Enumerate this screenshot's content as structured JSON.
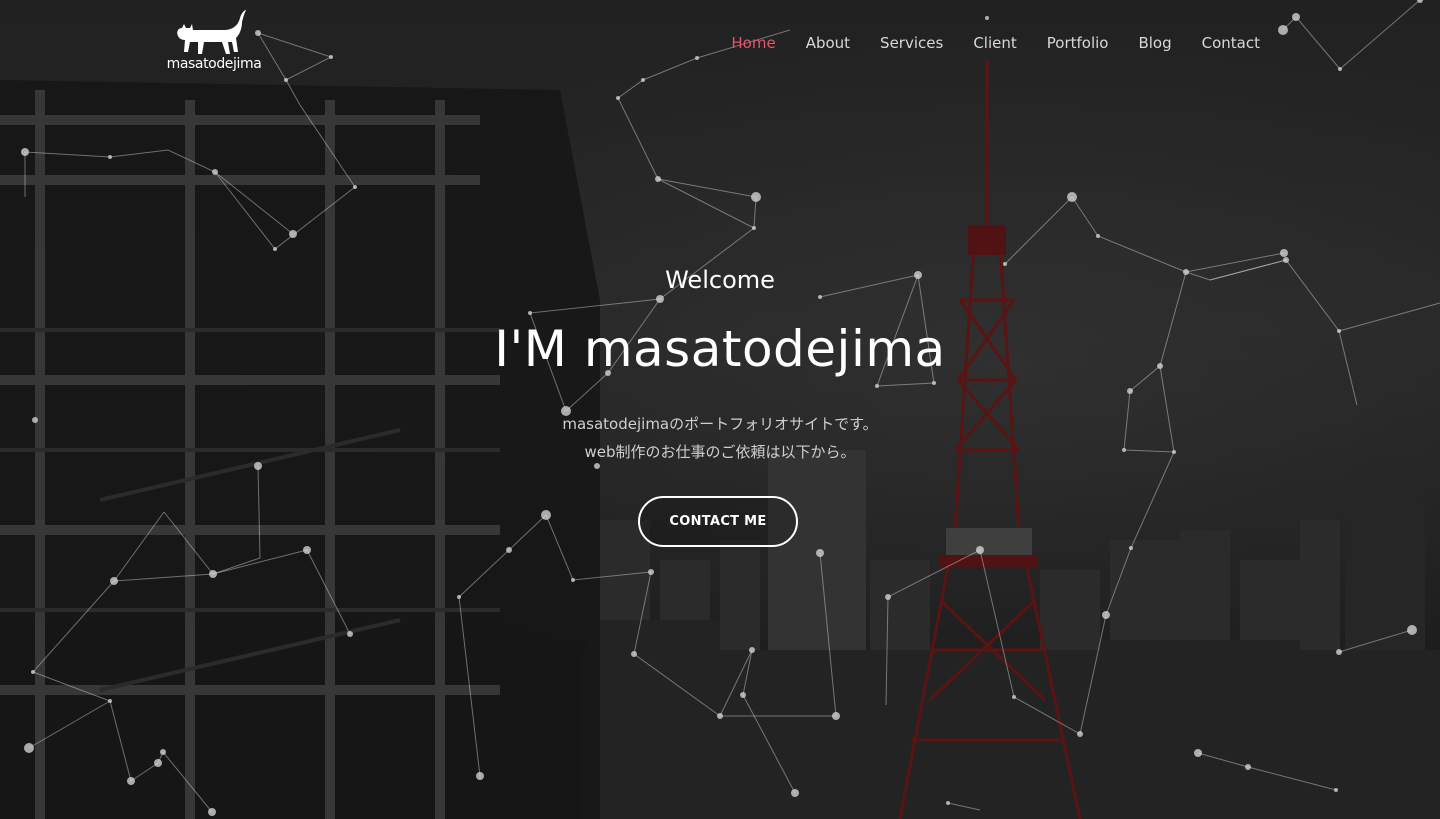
{
  "logo": {
    "text": "masatodejima",
    "icon": "cat-icon"
  },
  "nav": {
    "items": [
      {
        "label": "Home",
        "active": true
      },
      {
        "label": "About",
        "active": false
      },
      {
        "label": "Services",
        "active": false
      },
      {
        "label": "Client",
        "active": false
      },
      {
        "label": "Portfolio",
        "active": false
      },
      {
        "label": "Blog",
        "active": false
      },
      {
        "label": "Contact",
        "active": false
      }
    ]
  },
  "hero": {
    "welcome": "Welcome",
    "headline": "I'M masatodejima",
    "tagline_line1": "masatodejimaのポートフォリオサイトです。",
    "tagline_line2": "web制作のお仕事のご依頼は以下から。",
    "cta_label": "CONTACT ME"
  },
  "colors": {
    "accent": "#e8536c",
    "text": "#ffffff",
    "nav_text": "#d8d8d8",
    "tower_red": "#8a1d1d"
  }
}
